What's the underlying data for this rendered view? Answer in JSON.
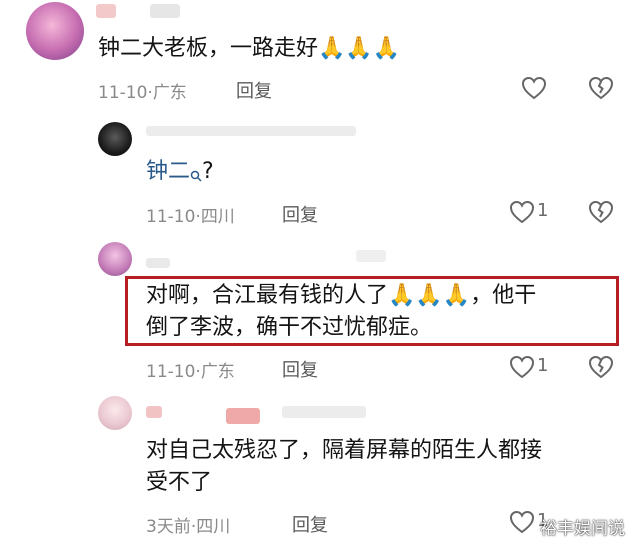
{
  "comments": [
    {
      "text": "钟二大老板，一路走好",
      "emoji": "🙏🙏🙏",
      "date": "11-10",
      "location": "广东",
      "reply_label": "回复",
      "likes": ""
    },
    {
      "text_link": "钟二",
      "text_suffix": "?",
      "date": "11-10",
      "location": "四川",
      "reply_label": "回复",
      "likes": "1"
    },
    {
      "text_line1a": "对啊，合江最有钱的人了",
      "emoji": "🙏🙏🙏",
      "text_line1b": "，他干",
      "text_line2": "倒了李波，确干不过忧郁症。",
      "date": "11-10",
      "location": "广东",
      "reply_label": "回复",
      "likes": "1"
    },
    {
      "text_line1": "对自己太残忍了，隔着屏幕的陌生人都接",
      "text_line2": "受不了",
      "date": "3天前",
      "location": "四川",
      "reply_label": "回复",
      "likes": "1"
    }
  ],
  "separator": "·",
  "watermark": "裕丰娱间说",
  "colors": {
    "highlight_border": "#b51f24",
    "link": "#2a5a8c"
  }
}
